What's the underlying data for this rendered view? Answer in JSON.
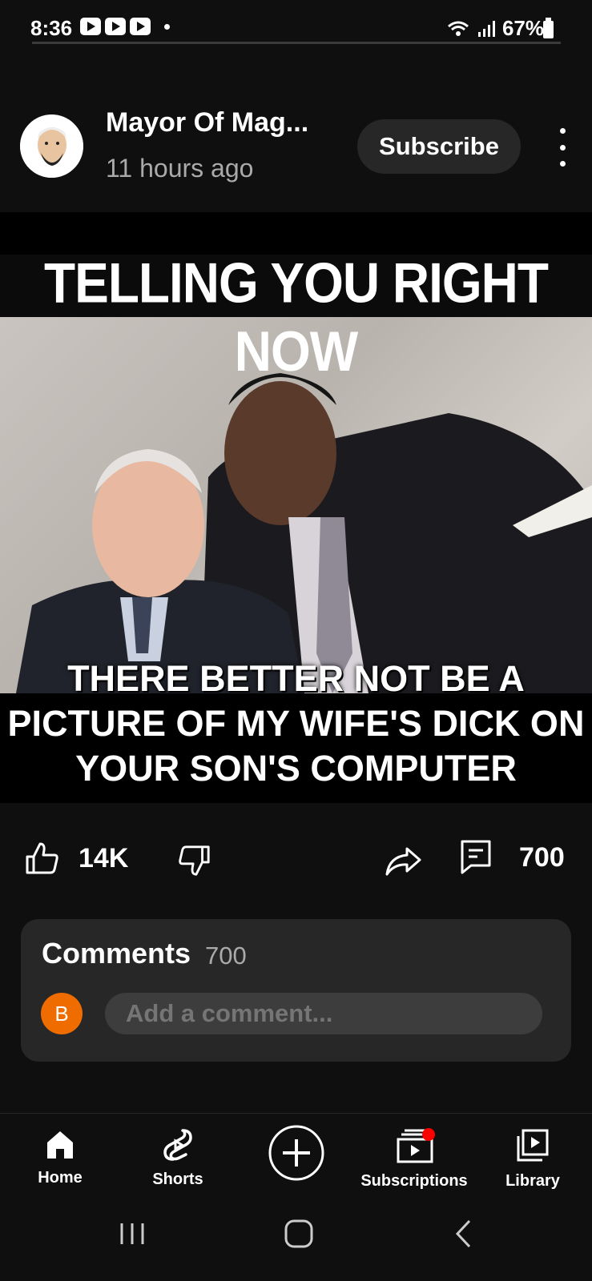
{
  "status_bar": {
    "time": "8:36",
    "battery": "67%"
  },
  "post": {
    "channel_name": "Mayor Of Mag...",
    "time_ago": "11 hours ago",
    "subscribe_label": "Subscribe",
    "image": {
      "top_text": "TELLING YOU RIGHT NOW",
      "bottom_text": "THERE BETTER NOT BE A PICTURE OF MY WIFE'S DICK ON YOUR SON'S COMPUTER"
    }
  },
  "actions": {
    "likes": "14K",
    "comments_count": "700"
  },
  "comments": {
    "title": "Comments",
    "count": "700",
    "user_initial": "B",
    "placeholder": "Add a comment..."
  },
  "nav": {
    "items": [
      {
        "label": "Home",
        "icon": "home-icon"
      },
      {
        "label": "Shorts",
        "icon": "shorts-icon"
      },
      {
        "label": "",
        "icon": "create-icon"
      },
      {
        "label": "Subscriptions",
        "icon": "subscriptions-icon"
      },
      {
        "label": "Library",
        "icon": "library-icon"
      }
    ]
  },
  "colors": {
    "background": "#0f0f0f",
    "panel": "#272727",
    "accent_red": "#ff0000",
    "avatar_orange": "#ef6c00"
  }
}
